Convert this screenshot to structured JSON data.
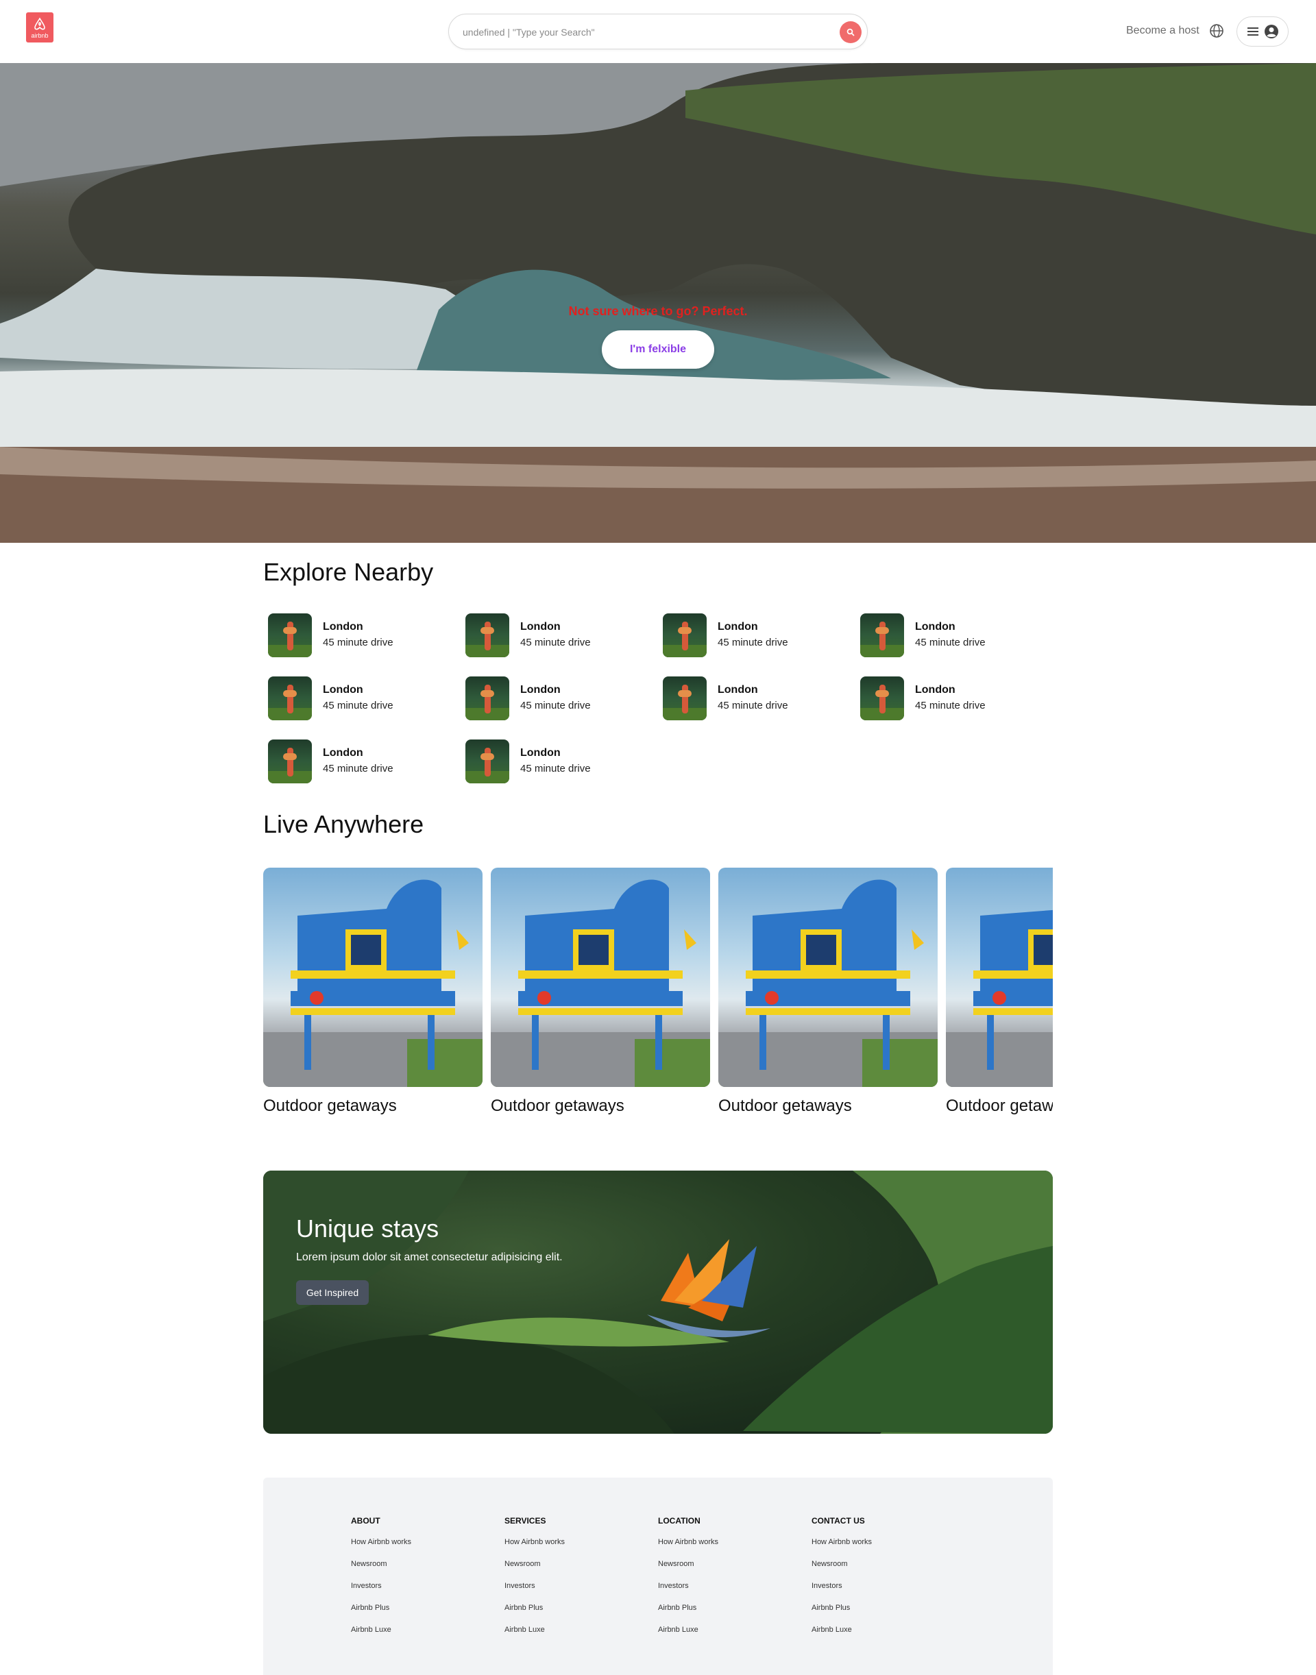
{
  "header": {
    "logo_text": "airbnb",
    "search_placeholder": "undefined | \"Type your Search\"",
    "become_host": "Become a host",
    "accent_color": "#f05a5f"
  },
  "hero": {
    "tagline": "Not sure where to go? Perfect.",
    "button_label": "I'm felxible"
  },
  "explore": {
    "title": "Explore Nearby",
    "items": [
      {
        "city": "London",
        "distance": "45 minute drive"
      },
      {
        "city": "London",
        "distance": "45 minute drive"
      },
      {
        "city": "London",
        "distance": "45 minute drive"
      },
      {
        "city": "London",
        "distance": "45 minute drive"
      },
      {
        "city": "London",
        "distance": "45 minute drive"
      },
      {
        "city": "London",
        "distance": "45 minute drive"
      },
      {
        "city": "London",
        "distance": "45 minute drive"
      },
      {
        "city": "London",
        "distance": "45 minute drive"
      },
      {
        "city": "London",
        "distance": "45 minute drive"
      },
      {
        "city": "London",
        "distance": "45 minute drive"
      }
    ]
  },
  "live": {
    "title": "Live Anywhere",
    "cards": [
      {
        "label": "Outdoor getaways"
      },
      {
        "label": "Outdoor getaways"
      },
      {
        "label": "Outdoor getaways"
      },
      {
        "label": "Outdoor getaways"
      }
    ]
  },
  "unique": {
    "title": "Unique stays",
    "description": "Lorem ipsum dolor sit amet consectetur adipisicing elit.",
    "button_label": "Get Inspired"
  },
  "footer": {
    "columns": [
      {
        "heading": "ABOUT",
        "links": [
          "How Airbnb works",
          "Newsroom",
          "Investors",
          "Airbnb Plus",
          "Airbnb Luxe"
        ]
      },
      {
        "heading": "SERVICES",
        "links": [
          "How Airbnb works",
          "Newsroom",
          "Investors",
          "Airbnb Plus",
          "Airbnb Luxe"
        ]
      },
      {
        "heading": "LOCATION",
        "links": [
          "How Airbnb works",
          "Newsroom",
          "Investors",
          "Airbnb Plus",
          "Airbnb Luxe"
        ]
      },
      {
        "heading": "CONTACT US",
        "links": [
          "How Airbnb works",
          "Newsroom",
          "Investors",
          "Airbnb Plus",
          "Airbnb Luxe"
        ]
      }
    ]
  }
}
